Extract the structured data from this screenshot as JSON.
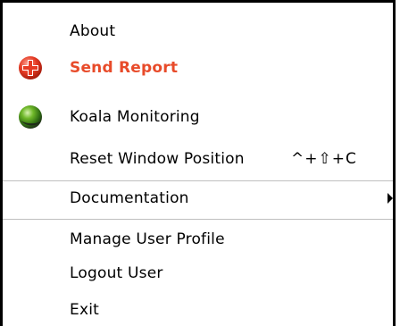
{
  "menu": {
    "about_label": "About",
    "send_report": {
      "label": "Send Report",
      "color": "#e84b2a",
      "icon": "red-cross-icon"
    },
    "koala_monitoring": {
      "label": "Koala Monitoring",
      "icon": "green-globe-icon"
    },
    "reset_window_position": {
      "label": "Reset Window Position",
      "shortcut": "^+⇧+C"
    },
    "documentation": {
      "label": "Documentation",
      "icon": "submenu-arrow-icon"
    },
    "manage_user_profile_label": "Manage User Profile",
    "logout_user_label": "Logout User",
    "exit_label": "Exit"
  }
}
